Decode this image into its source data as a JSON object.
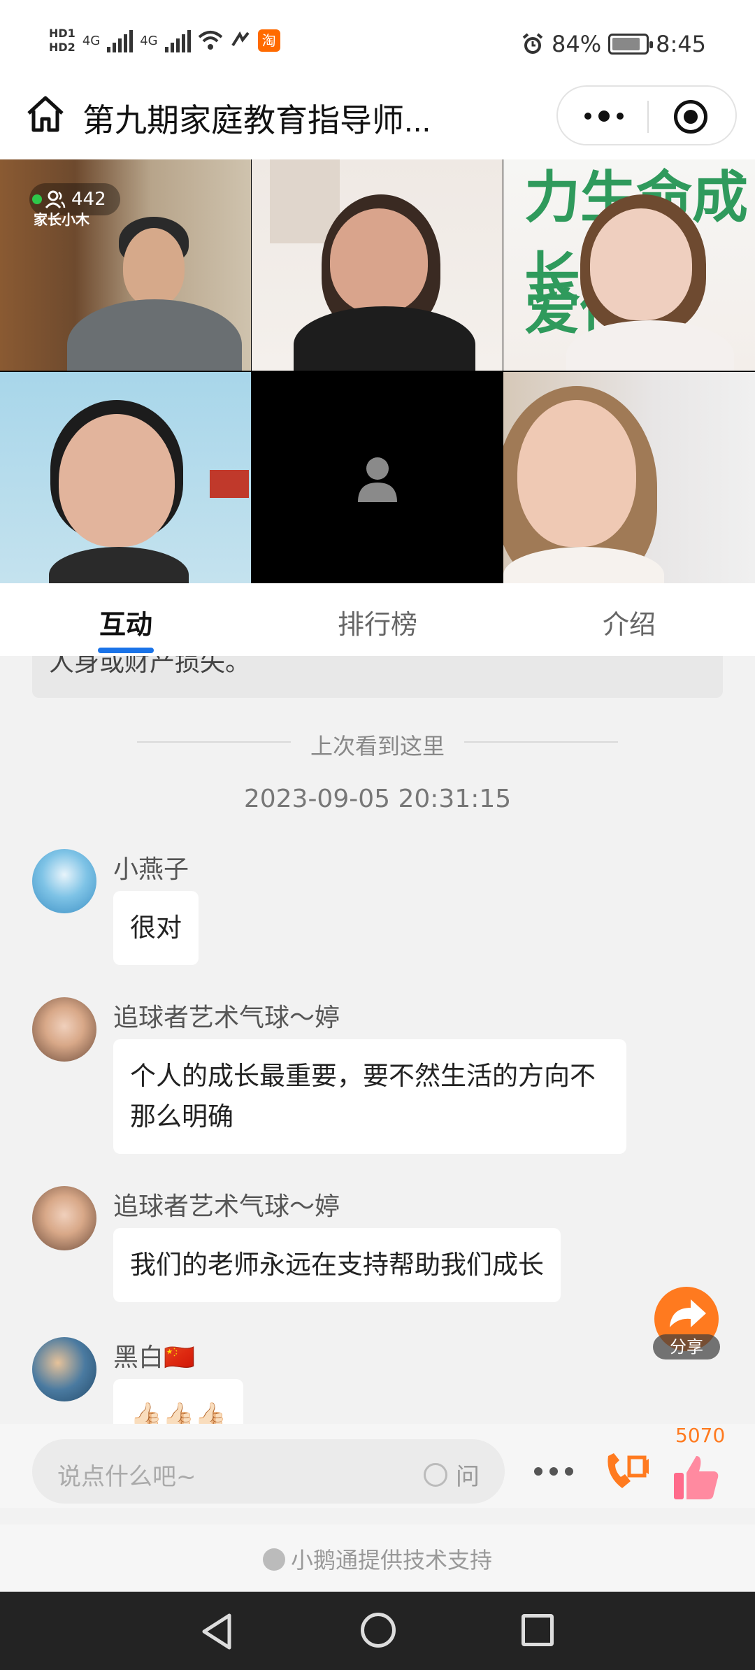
{
  "status_bar": {
    "hd1": "HD1",
    "hd2": "HD2",
    "net1": "4G",
    "net2": "4G",
    "alarm_icon": "alarm-icon",
    "battery": "84%",
    "battery_level": 0.84,
    "time": "8:45"
  },
  "header": {
    "title": "第九期家庭教育指导师...",
    "home_icon": "home-icon",
    "more_icon": "more-dots-icon",
    "close_icon": "mini-program-close-icon"
  },
  "video": {
    "viewers": "442",
    "brand": "家长小木",
    "poster_text_1": "力生命成长",
    "poster_text_2": "爱传"
  },
  "tabs": [
    {
      "label": "互动",
      "active": true
    },
    {
      "label": "排行榜",
      "active": false
    },
    {
      "label": "介绍",
      "active": false
    }
  ],
  "chat": {
    "notice_tail": "人身或财产损失。",
    "seen_label": "上次看到这里",
    "timestamp": "2023-09-05 20:31:15",
    "messages": [
      {
        "nick": "小燕子",
        "text": "很对"
      },
      {
        "nick": "追球者艺术气球～婷",
        "text": "个人的成长最重要，要不然生活的方向不那么明确"
      },
      {
        "nick": "追球者艺术气球～婷",
        "text": "我们的老师永远在支持帮助我们成长"
      },
      {
        "nick": "黑白🇨🇳",
        "text": "👍🏻👍🏻👍🏻"
      }
    ]
  },
  "share": {
    "label": "分享"
  },
  "input": {
    "placeholder": "说点什么吧~",
    "ask_label": "问"
  },
  "likes": {
    "count": "5070"
  },
  "footer": {
    "text": "小鹅通提供技术支持"
  },
  "colors": {
    "accent": "#1a73e8",
    "orange": "#ff7a1f",
    "like_pink": "#ff6b8b"
  }
}
